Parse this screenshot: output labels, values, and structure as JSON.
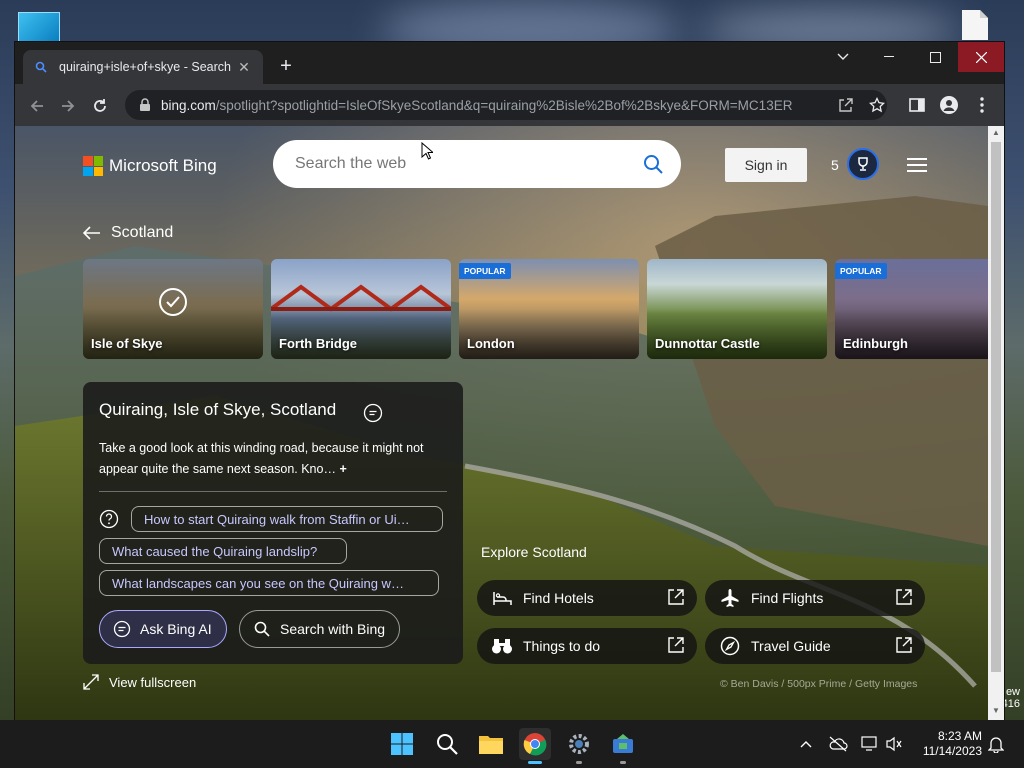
{
  "browser": {
    "tab_title": "quiraing+isle+of+skye - Search",
    "url_host": "bing.com",
    "url_path": "/spotlight?spotlightid=IsleOfSkyeScotland&q=quiraing%2Bisle%2Bof%2Bskye&FORM=MC13ER"
  },
  "bing": {
    "brand": "Microsoft Bing",
    "search_placeholder": "Search the web",
    "sign_in": "Sign in",
    "rewards_count": "5",
    "back_label": "Scotland",
    "cards": [
      {
        "label": "Isle of Skye",
        "badge": "",
        "selected": true
      },
      {
        "label": "Forth Bridge",
        "badge": "",
        "selected": false
      },
      {
        "label": "London",
        "badge": "POPULAR",
        "selected": false
      },
      {
        "label": "Dunnottar Castle",
        "badge": "",
        "selected": false
      },
      {
        "label": "Edinburgh",
        "badge": "POPULAR",
        "selected": false
      }
    ],
    "panel": {
      "title": "Quiraing, Isle of Skye, Scotland",
      "description": "Take a good look at this winding road, because it might not appear quite the same next season. Kno…",
      "questions": [
        "How to start Quiraing walk from Staffin or Ui…",
        "What caused the Quiraing landslip?",
        "What landscapes can you see on the Quiraing w…"
      ],
      "ask_ai": "Ask Bing AI",
      "search_bing": "Search with Bing"
    },
    "fullscreen": "View fullscreen",
    "explore": {
      "title": "Explore Scotland",
      "buttons": [
        {
          "label": "Find Hotels",
          "icon": "bed-icon"
        },
        {
          "label": "Find Flights",
          "icon": "airplane-icon"
        },
        {
          "label": "Things to do",
          "icon": "binoculars-icon"
        },
        {
          "label": "Travel Guide",
          "icon": "compass-icon"
        }
      ]
    },
    "credit": "© Ben Davis / 500px Prime / Getty Images"
  },
  "desktop": {
    "edge_text_1": "ew",
    "edge_text_2": "416"
  },
  "taskbar": {
    "time": "8:23 AM",
    "date": "11/14/2023"
  },
  "colors": {
    "bing_accent": "#2a6ee8",
    "chip_text": "#c7c7ff",
    "close_button": "#8b1a25"
  }
}
